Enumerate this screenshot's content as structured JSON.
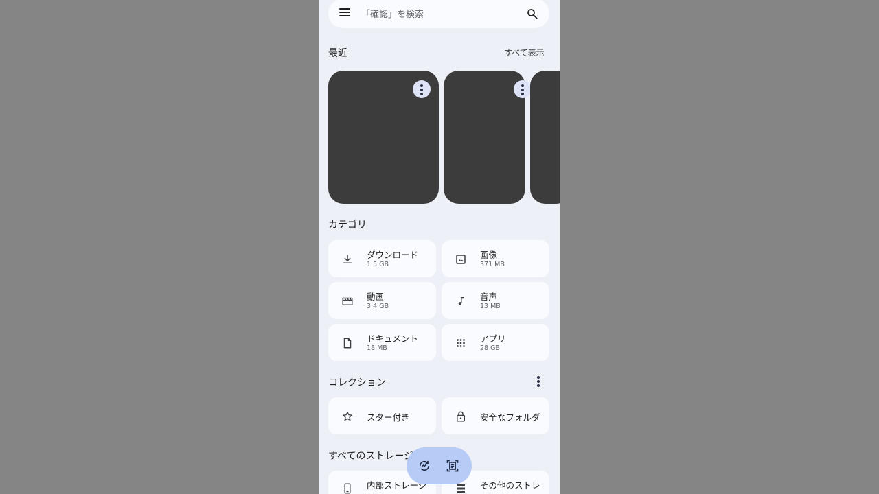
{
  "search": {
    "placeholder": "「確認」を検索"
  },
  "recent": {
    "title": "最近",
    "see_all": "すべて表示"
  },
  "categories": {
    "title": "カテゴリ",
    "items": [
      {
        "name": "ダウンロード",
        "size": "1.5 GB",
        "icon": "download-icon"
      },
      {
        "name": "画像",
        "size": "371 MB",
        "icon": "image-icon"
      },
      {
        "name": "動画",
        "size": "3.4 GB",
        "icon": "video-icon"
      },
      {
        "name": "音声",
        "size": "13 MB",
        "icon": "music-note-icon"
      },
      {
        "name": "ドキュメント",
        "size": "18 MB",
        "icon": "document-icon"
      },
      {
        "name": "アプリ",
        "size": "28 GB",
        "icon": "apps-grid-icon"
      }
    ]
  },
  "collections": {
    "title": "コレクション",
    "items": [
      {
        "name": "スター付き",
        "icon": "star-icon"
      },
      {
        "name": "安全なフォルダ",
        "icon": "lock-icon"
      }
    ]
  },
  "storage": {
    "title": "すべてのストレージ",
    "items": [
      {
        "name": "内部ストレージ",
        "icon": "phone-icon"
      },
      {
        "name": "その他のストレ",
        "icon": "storage-icon"
      }
    ]
  },
  "colors": {
    "accent_chip": "#dfe3f7",
    "fab": "#b7cbf7",
    "thumbnail": "#3c3c3c"
  }
}
